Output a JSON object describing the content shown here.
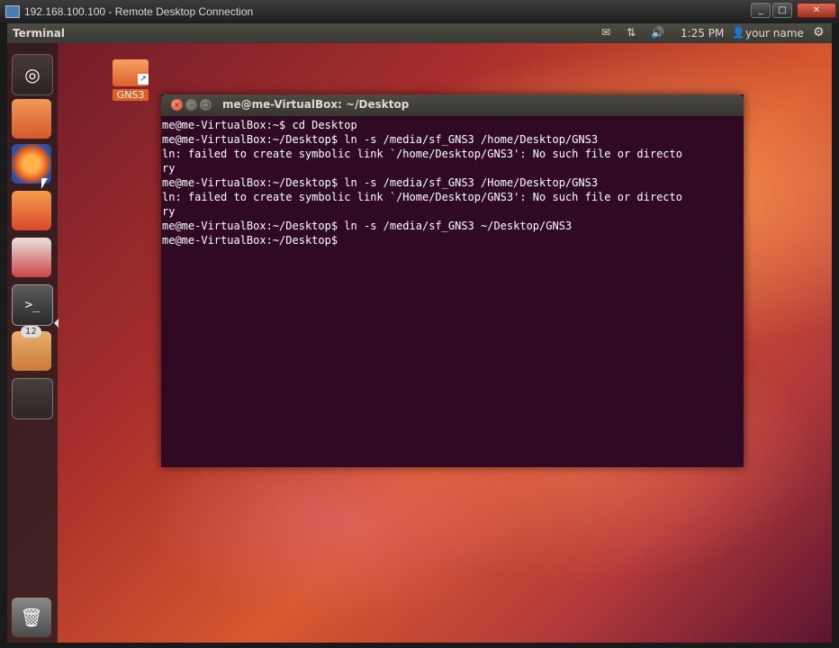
{
  "rdp": {
    "title": "192.168.100.100 - Remote Desktop Connection",
    "min": "_",
    "max": "□",
    "close": "✕"
  },
  "panel": {
    "app_name": "Terminal",
    "mail_icon": "✉",
    "network_icon": "⇅",
    "volume_icon": "🔊",
    "time": "1:25 PM",
    "user_icon": "👤",
    "user": "your name",
    "power_icon": "⚙"
  },
  "launcher": {
    "dash_glyph": "◎",
    "terminal_glyph": ">_",
    "update_badge": "12",
    "trash_glyph": "🗑"
  },
  "desktop": {
    "gns3_label": "GNS3",
    "link_glyph": "↗"
  },
  "terminal": {
    "title": "me@me-VirtualBox: ~/Desktop",
    "close": "×",
    "min": "–",
    "max": "□",
    "lines": [
      "me@me-VirtualBox:~$ cd Desktop",
      "me@me-VirtualBox:~/Desktop$ ln -s /media/sf_GNS3 /home/Desktop/GNS3",
      "ln: failed to create symbolic link `/home/Desktop/GNS3': No such file or directo",
      "ry",
      "me@me-VirtualBox:~/Desktop$ ln -s /media/sf_GNS3 /Home/Desktop/GNS3",
      "ln: failed to create symbolic link `/Home/Desktop/GNS3': No such file or directo",
      "ry",
      "me@me-VirtualBox:~/Desktop$ ln -s /media/sf_GNS3 ~/Desktop/GNS3",
      "me@me-VirtualBox:~/Desktop$"
    ]
  }
}
